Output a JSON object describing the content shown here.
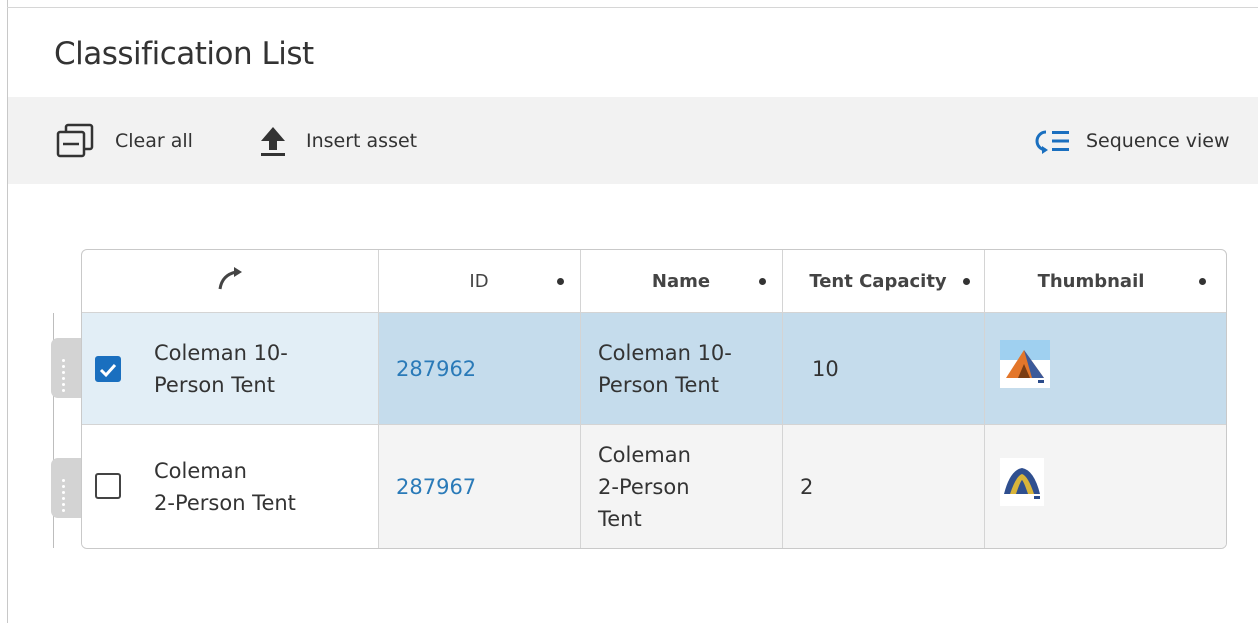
{
  "page": {
    "title": "Classification List"
  },
  "toolbar": {
    "clear_all": {
      "label": "Clear all",
      "icon": "clear-all-icon"
    },
    "insert_asset": {
      "label": "Insert asset",
      "icon": "upload-icon"
    },
    "sequence_view": {
      "label": "Sequence view",
      "icon": "sequence-view-icon"
    }
  },
  "colors": {
    "accent": "#1a6fbf",
    "link": "#2a7ab8",
    "selected_row": "#c5dcec",
    "selected_first_cell": "#e2eef6",
    "row_alt": "#f4f4f4",
    "toolbar_bg": "#f2f2f2"
  },
  "table": {
    "columns": [
      {
        "label": "",
        "icon": "reorder-arrow-icon"
      },
      {
        "label": "ID"
      },
      {
        "label": "Name"
      },
      {
        "label": "Tent Capacity"
      },
      {
        "label": "Thumbnail"
      }
    ],
    "rows": [
      {
        "selected": true,
        "label_line1": "Coleman 10-",
        "label_line2": "Person Tent",
        "id": "287962",
        "name_line1": "Coleman 10-",
        "name_line2": "Person Tent",
        "name_line3": "",
        "capacity": "10",
        "thumbnail": "orange-tent-thumbnail"
      },
      {
        "selected": false,
        "label_line1": "Coleman",
        "label_line2": "2-Person Tent",
        "id": "287967",
        "name_line1": "Coleman",
        "name_line2": "2-Person",
        "name_line3": "Tent",
        "capacity": "2",
        "thumbnail": "blue-tent-thumbnail"
      }
    ]
  }
}
